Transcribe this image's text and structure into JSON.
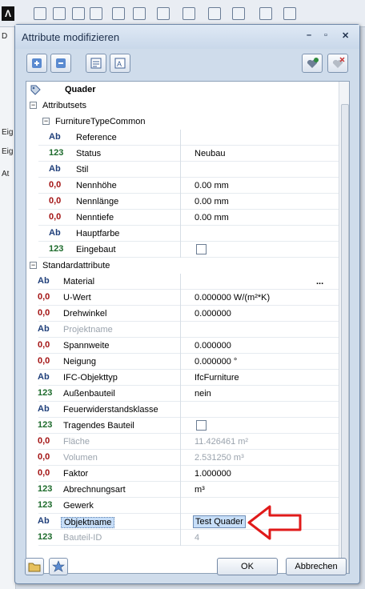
{
  "app": {
    "logo": "Λ",
    "left_labels": [
      "D",
      "Eig",
      "Eig",
      "At"
    ]
  },
  "dialog": {
    "title": "Attribute modifizieren",
    "window_buttons": [
      "–",
      "▫",
      "✕"
    ],
    "toolbar_icons": [
      "add-set-icon",
      "remove-set-icon",
      "favorites-icon",
      "filter-icon",
      "add-favorite-icon",
      "delete-favorite-icon"
    ],
    "ok_label": "OK",
    "cancel_label": "Abbrechen",
    "bottom_icons": [
      "open-icon",
      "favorite-star-icon"
    ]
  },
  "tree": {
    "root": "Quader",
    "groups": [
      "Attributsets",
      "FurnitureTypeCommon",
      "Standardattribute"
    ],
    "furniture_rows": [
      {
        "type": "Ab",
        "name": "Reference",
        "value": ""
      },
      {
        "type": "123",
        "name": "Status",
        "value": "Neubau"
      },
      {
        "type": "Ab",
        "name": "Stil",
        "value": ""
      },
      {
        "type": "0,0",
        "name": "Nennhöhe",
        "value": "0.00 mm"
      },
      {
        "type": "0,0",
        "name": "Nennlänge",
        "value": "0.00 mm"
      },
      {
        "type": "0,0",
        "name": "Nenntiefe",
        "value": "0.00 mm"
      },
      {
        "type": "Ab",
        "name": "Hauptfarbe",
        "value": ""
      },
      {
        "type": "123",
        "name": "Eingebaut",
        "value": "checkbox",
        "checked": false
      }
    ],
    "standard_rows": [
      {
        "type": "Ab",
        "name": "Material",
        "value": "..."
      },
      {
        "type": "0,0",
        "name": "U-Wert",
        "value": "0.000000 W/(m²*K)"
      },
      {
        "type": "0,0",
        "name": "Drehwinkel",
        "value": "0.000000"
      },
      {
        "type": "Ab",
        "name": "Projektname",
        "value": "",
        "dim": true
      },
      {
        "type": "0,0",
        "name": "Spannweite",
        "value": "0.000000"
      },
      {
        "type": "0,0",
        "name": "Neigung",
        "value": "0.000000 °"
      },
      {
        "type": "Ab",
        "name": "IFC-Objekttyp",
        "value": "IfcFurniture"
      },
      {
        "type": "123",
        "name": "Außenbauteil",
        "value": "nein"
      },
      {
        "type": "Ab",
        "name": "Feuerwiderstandsklasse",
        "value": ""
      },
      {
        "type": "123",
        "name": "Tragendes Bauteil",
        "value": "checkbox",
        "checked": false
      },
      {
        "type": "0,0",
        "name": "Fläche",
        "value": "11.426461 m²",
        "dim": true
      },
      {
        "type": "0,0",
        "name": "Volumen",
        "value": "2.531250 m³",
        "dim": true
      },
      {
        "type": "0,0",
        "name": "Faktor",
        "value": "1.000000"
      },
      {
        "type": "123",
        "name": "Abrechnungsart",
        "value": "m³"
      },
      {
        "type": "123",
        "name": "Gewerk",
        "value": ""
      },
      {
        "type": "Ab",
        "name": "Objektname",
        "value": "Test Quader",
        "editing": true
      },
      {
        "type": "123",
        "name": "Bauteil-ID",
        "value": "4",
        "dim": true
      }
    ]
  },
  "colors": {
    "annotation_arrow": "#e01a1a",
    "selection": "#c7def8"
  }
}
